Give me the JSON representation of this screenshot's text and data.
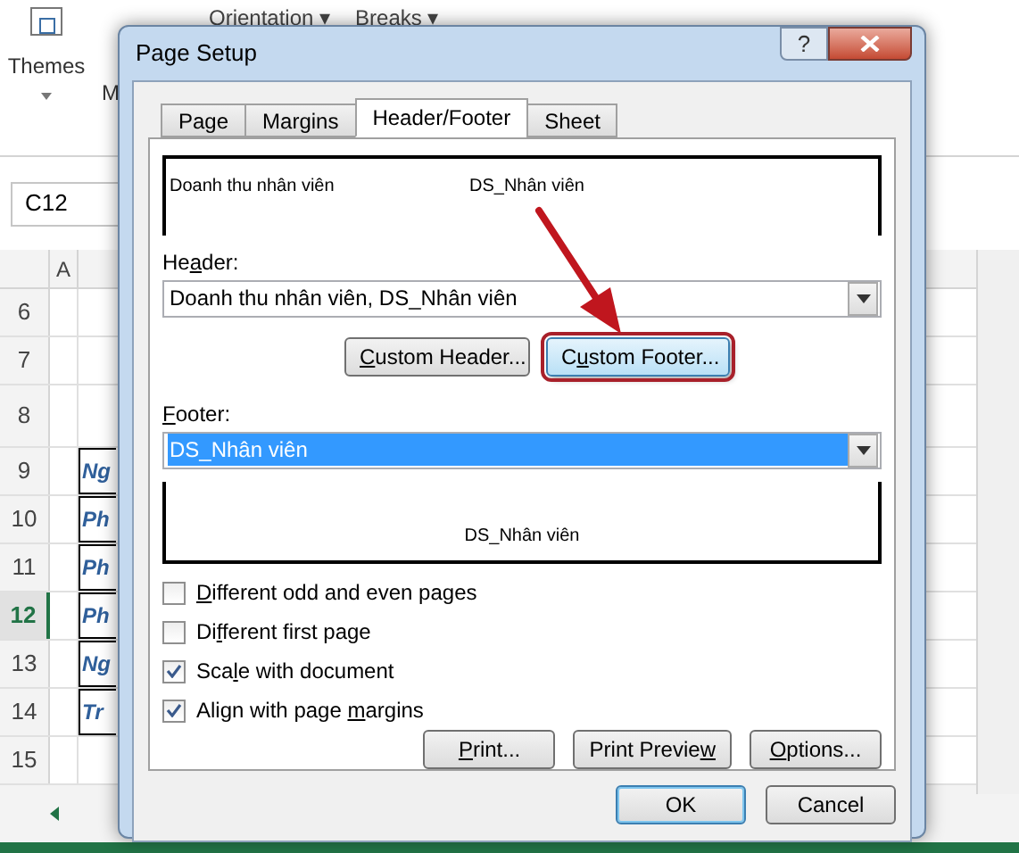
{
  "ribbon": {
    "themes_button": "Themes",
    "cut_label": "M",
    "items": [
      "Orientation ▾",
      "Breaks ▾"
    ]
  },
  "name_box": "C12",
  "column_headers": [
    "A"
  ],
  "rows": [
    {
      "number": "6",
      "selected": false
    },
    {
      "number": "7",
      "selected": false
    },
    {
      "number": "8",
      "selected": false,
      "kind": "tall"
    },
    {
      "number": "9",
      "selected": false,
      "cell": "Ng"
    },
    {
      "number": "10",
      "selected": false,
      "cell": "Ph"
    },
    {
      "number": "11",
      "selected": false,
      "cell": "Ph"
    },
    {
      "number": "12",
      "selected": true,
      "cell": "Ph"
    },
    {
      "number": "13",
      "selected": false,
      "cell": "Ng"
    },
    {
      "number": "14",
      "selected": false,
      "cell": "Tr"
    },
    {
      "number": "15",
      "selected": false
    }
  ],
  "dialog": {
    "title": "Page Setup",
    "help_button": "?",
    "tabs": [
      {
        "label": "Page",
        "selected": false
      },
      {
        "label": "Margins",
        "selected": false
      },
      {
        "label": "Header/Footer",
        "selected": true
      },
      {
        "label": "Sheet",
        "selected": false
      }
    ],
    "header_preview": {
      "left": "Doanh thu nhân viên",
      "center": "DS_Nhân viên"
    },
    "header": {
      "label": {
        "pre": "He",
        "key": "a",
        "post": "der:"
      },
      "value": "Doanh thu nhân viên, DS_Nhân viên",
      "selected": false
    },
    "custom_buttons": [
      {
        "label": {
          "key": "C",
          "post": "ustom Header..."
        },
        "highlighted": false
      },
      {
        "label": {
          "pre": "C",
          "key": "u",
          "post": "stom Footer..."
        },
        "highlighted": true
      }
    ],
    "footer": {
      "label": {
        "key": "F",
        "post": "ooter:"
      },
      "value": "DS_Nhân viên",
      "selected": true
    },
    "footer_preview": {
      "center": "DS_Nhân viên"
    },
    "options": [
      {
        "label": {
          "key": "D",
          "post": "ifferent odd and even pages"
        },
        "checked": false
      },
      {
        "label": {
          "pre": "Di",
          "key": "f",
          "post": "ferent first page"
        },
        "checked": false
      },
      {
        "label": {
          "pre": "Sca",
          "key": "l",
          "post": "e with document"
        },
        "checked": true
      },
      {
        "label": {
          "pre": "Align with page ",
          "key": "m",
          "post": "argins"
        },
        "checked": true
      }
    ],
    "page_buttons": [
      {
        "label": {
          "key": "P",
          "post": "rint..."
        }
      },
      {
        "label": {
          "pre": "Print Previe",
          "key": "w"
        }
      },
      {
        "label": {
          "key": "O",
          "post": "ptions..."
        }
      }
    ],
    "footer_buttons": [
      {
        "label": {
          "pre": "OK"
        },
        "default": true
      },
      {
        "label": {
          "pre": "Cancel"
        },
        "default": false
      }
    ]
  }
}
